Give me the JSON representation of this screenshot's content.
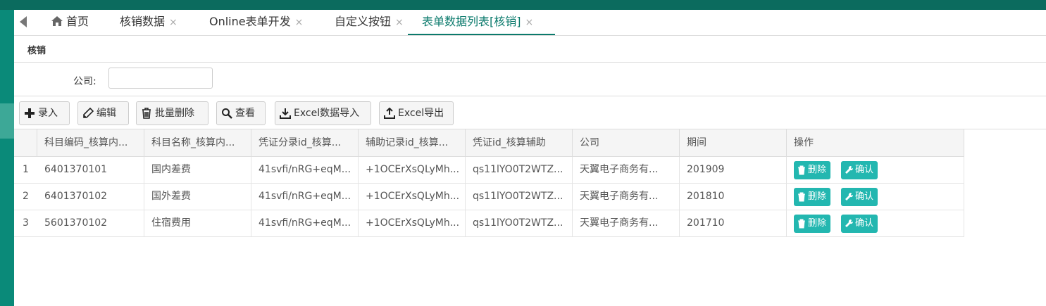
{
  "tabs": [
    {
      "label": "首页",
      "closable": false,
      "icon": "home-icon"
    },
    {
      "label": "核销数据",
      "closable": true
    },
    {
      "label": "Online表单开发",
      "closable": true
    },
    {
      "label": "自定义按钮",
      "closable": true
    },
    {
      "label": "表单数据列表[核销]",
      "closable": true,
      "active": true
    }
  ],
  "close_glyph": "×",
  "panel": {
    "title": "核销"
  },
  "search": {
    "company_label": "公司:",
    "company_value": ""
  },
  "toolbar": {
    "add": "录入",
    "edit": "编辑",
    "batch_delete": "批量删除",
    "view": "查看",
    "excel_import": "Excel数据导入",
    "excel_export": "Excel导出"
  },
  "table": {
    "headers": [
      "科目编码_核算内...",
      "科目名称_核算内...",
      "凭证分录id_核算...",
      "辅助记录id_核算...",
      "凭证id_核算辅助",
      "公司",
      "期间",
      "操作"
    ],
    "rows": [
      {
        "no": "1",
        "cells": [
          "6401370101",
          "国内差费",
          "41svfi/nRG+eqM...",
          "+1OCErXsQLyMh...",
          "qs11lYO0T2WTZ...",
          "天翼电子商务有...",
          "201909"
        ]
      },
      {
        "no": "2",
        "cells": [
          "6401370102",
          "国外差费",
          "41svfi/nRG+eqM...",
          "+1OCErXsQLyMh...",
          "qs11lYO0T2WTZ...",
          "天翼电子商务有...",
          "201810"
        ]
      },
      {
        "no": "3",
        "cells": [
          "5601370102",
          "住宿费用",
          "41svfi/nRG+eqM...",
          "+1OCErXsQLyMh...",
          "qs11lYO0T2WTZ...",
          "天翼电子商务有...",
          "201710"
        ]
      }
    ],
    "row_actions": {
      "delete": "删除",
      "confirm": "确认"
    }
  },
  "colors": {
    "accent": "#0b7a6c",
    "topbar": "#0b6b5e",
    "sidebar": "#0a8a79",
    "action_button": "#23b7b0"
  }
}
